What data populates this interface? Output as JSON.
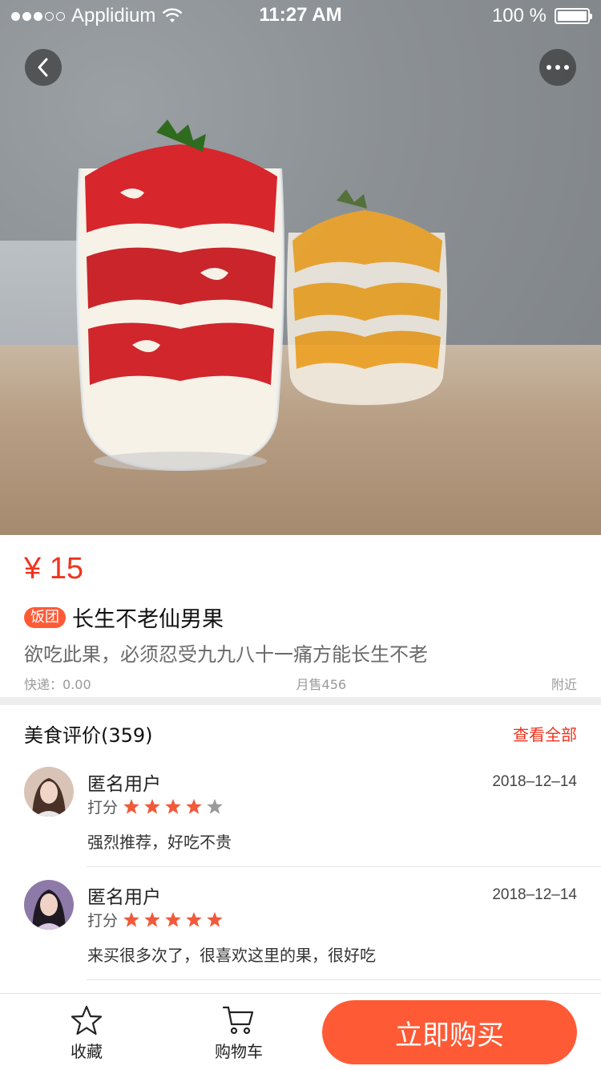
{
  "status_bar": {
    "carrier": "Applidium",
    "time": "11:27 AM",
    "battery": "100 %",
    "signal_strength": "3 of 5",
    "battery_level": 1.0
  },
  "hero": {
    "image_desc_icon": "product-photo-icon"
  },
  "product": {
    "price": "¥ 15",
    "tag": "饭团",
    "title": "长生不老仙男果",
    "subtitle": "欲吃此果，必须忍受九九八十一痛方能长生不老",
    "shipping": "快递：0.00",
    "monthly_sales": "月售456",
    "location": "附近"
  },
  "reviews": {
    "title": "美食评价(359)",
    "see_all": "查看全部",
    "rating_label": "打分",
    "items": [
      {
        "user": "匿名用户",
        "date": "2018–12–14",
        "rating": 4,
        "text": "强烈推荐，好吃不贵"
      },
      {
        "user": "匿名用户",
        "date": "2018–12–14",
        "rating": 5,
        "text": "来买很多次了，很喜欢这里的果，很好吃"
      }
    ]
  },
  "bottom_bar": {
    "favorite_label": "收藏",
    "cart_label": "购物车",
    "buy_label": "立即购买"
  },
  "colors": {
    "accent": "#ff5a36",
    "price": "#f0341d",
    "star_on": "#f05a3a",
    "star_off": "#9a9a9a"
  }
}
